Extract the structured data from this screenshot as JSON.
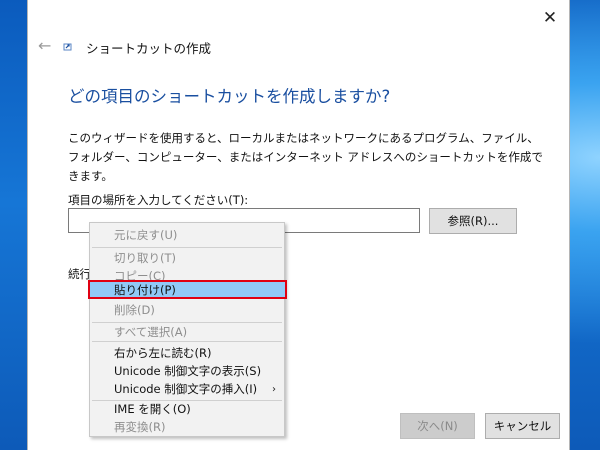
{
  "window": {
    "title": "ショートカットの作成",
    "close_glyph": "✕",
    "back_glyph": "←"
  },
  "heading": "どの項目のショートカットを作成しますか?",
  "description": "このウィザードを使用すると、ローカルまたはネットワークにあるプログラム、ファイル、フォルダー、コンピューター、またはインターネット アドレスへのショートカットを作成できます。",
  "location": {
    "label": "項目の場所を入力してください(T):",
    "value": "",
    "browse_label": "参照(R)..."
  },
  "continue_label": "続行",
  "buttons": {
    "next_label": "次へ(N)",
    "cancel_label": "キャンセル"
  },
  "context_menu": {
    "items": [
      {
        "label": "元に戻す(U)",
        "enabled": false
      },
      {
        "label": "切り取り(T)",
        "enabled": false
      },
      {
        "label": "コピー(C)",
        "enabled": false
      },
      {
        "label": "貼り付け(P)",
        "enabled": true,
        "highlighted": true
      },
      {
        "label": "削除(D)",
        "enabled": false
      },
      {
        "label": "すべて選択(A)",
        "enabled": false
      },
      {
        "label": "右から左に読む(R)",
        "enabled": true
      },
      {
        "label": "Unicode 制御文字の表示(S)",
        "enabled": true
      },
      {
        "label": "Unicode 制御文字の挿入(I)",
        "enabled": true,
        "submenu_glyph": "›"
      },
      {
        "label": "IME を開く(O)",
        "enabled": true
      },
      {
        "label": "再変換(R)",
        "enabled": false
      }
    ]
  },
  "colors": {
    "heading": "#1a4fa0",
    "highlight_bg": "#91c9f7",
    "highlight_border": "#e00012",
    "disabled_text": "#8e8e8e"
  }
}
